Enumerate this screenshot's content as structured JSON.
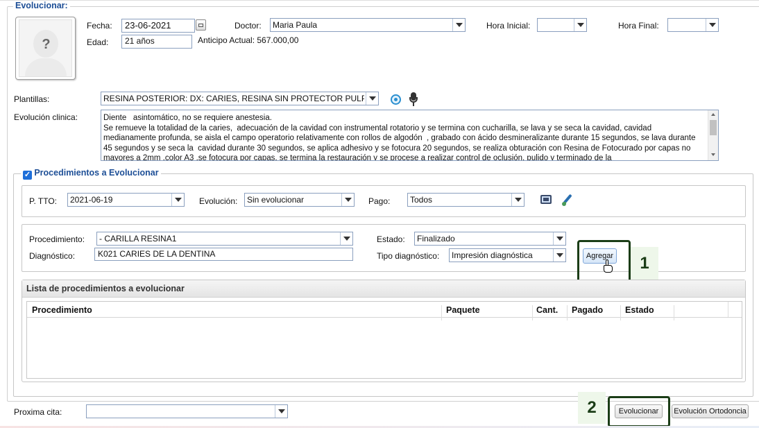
{
  "section_title": "Evolucionar:",
  "header": {
    "fecha_label": "Fecha:",
    "fecha_value": "23-06-2021",
    "doctor_label": "Doctor:",
    "doctor_value": "Maria Paula",
    "hora_inicial_label": "Hora Inicial:",
    "hora_inicial_value": "",
    "hora_final_label": "Hora Final:",
    "hora_final_value": "",
    "edad_label": "Edad:",
    "edad_value": "21 años",
    "anticipo_text": "Anticipo Actual: 567.000,00",
    "avatar_text": "?"
  },
  "plantillas": {
    "label": "Plantillas:",
    "value": "RESINA POSTERIOR: DX: CARIES, RESINA SIN PROTECTOR PULPAR Y"
  },
  "evolucion": {
    "label": "Evolución clinica:",
    "text": "Diente   asintomático, no se requiere anestesia.\nSe remueve la totalidad de la caries,  adecuación de la cavidad con instrumental rotatorio y se termina con cucharilla, se lava y se seca la cavidad, cavidad medianamente profunda, se aisla el campo operatorio relativamente con rollos de algodón  , grabado con ácido desmineralizante durante 15 segundos, se lava durante 45 segundos y se seca la  cavidad durante 30 segundos, se aplica adhesivo y se fotocura 20 segundos, se realiza obturación con Resina de Fotocurado por capas no mayores a 2mm ,color A3 ,se fotocura por capas, se termina la restauración y se procese a realizar control de oclusión, pulido y terminado de la"
  },
  "procedimientos": {
    "legend": "Procedimientos a Evolucionar",
    "checked": true,
    "ptto_label": "P. TTO:",
    "ptto_value": "2021-06-19",
    "evolucion_label": "Evolución:",
    "evolucion_value": "Sin evolucionar",
    "pago_label": "Pago:",
    "pago_value": "Todos",
    "procedimiento_label": "Procedimiento:",
    "procedimiento_value": "- CARILLA RESINA1",
    "diagnostico_label": "Diagnóstico:",
    "diagnostico_value": "K021 CARIES DE LA DENTINA",
    "estado_label": "Estado:",
    "estado_value": "Finalizado",
    "tipo_label": "Tipo diagnóstico:",
    "tipo_value": "Impresión diagnóstica",
    "agregar_label": "Agregar"
  },
  "lista": {
    "title": "Lista de procedimientos a evolucionar",
    "columns": [
      "Procedimiento",
      "Paquete",
      "Cant.",
      "Pagado",
      "Estado"
    ]
  },
  "footer": {
    "proxima_label": "Proxima cita:",
    "proxima_value": "",
    "evolucionar_label": "Evolucionar",
    "ortodoncia_label": "Evolución Ortodoncia"
  },
  "annotations": {
    "step1": "1",
    "step2": "2",
    "color": "#1b3d17"
  }
}
